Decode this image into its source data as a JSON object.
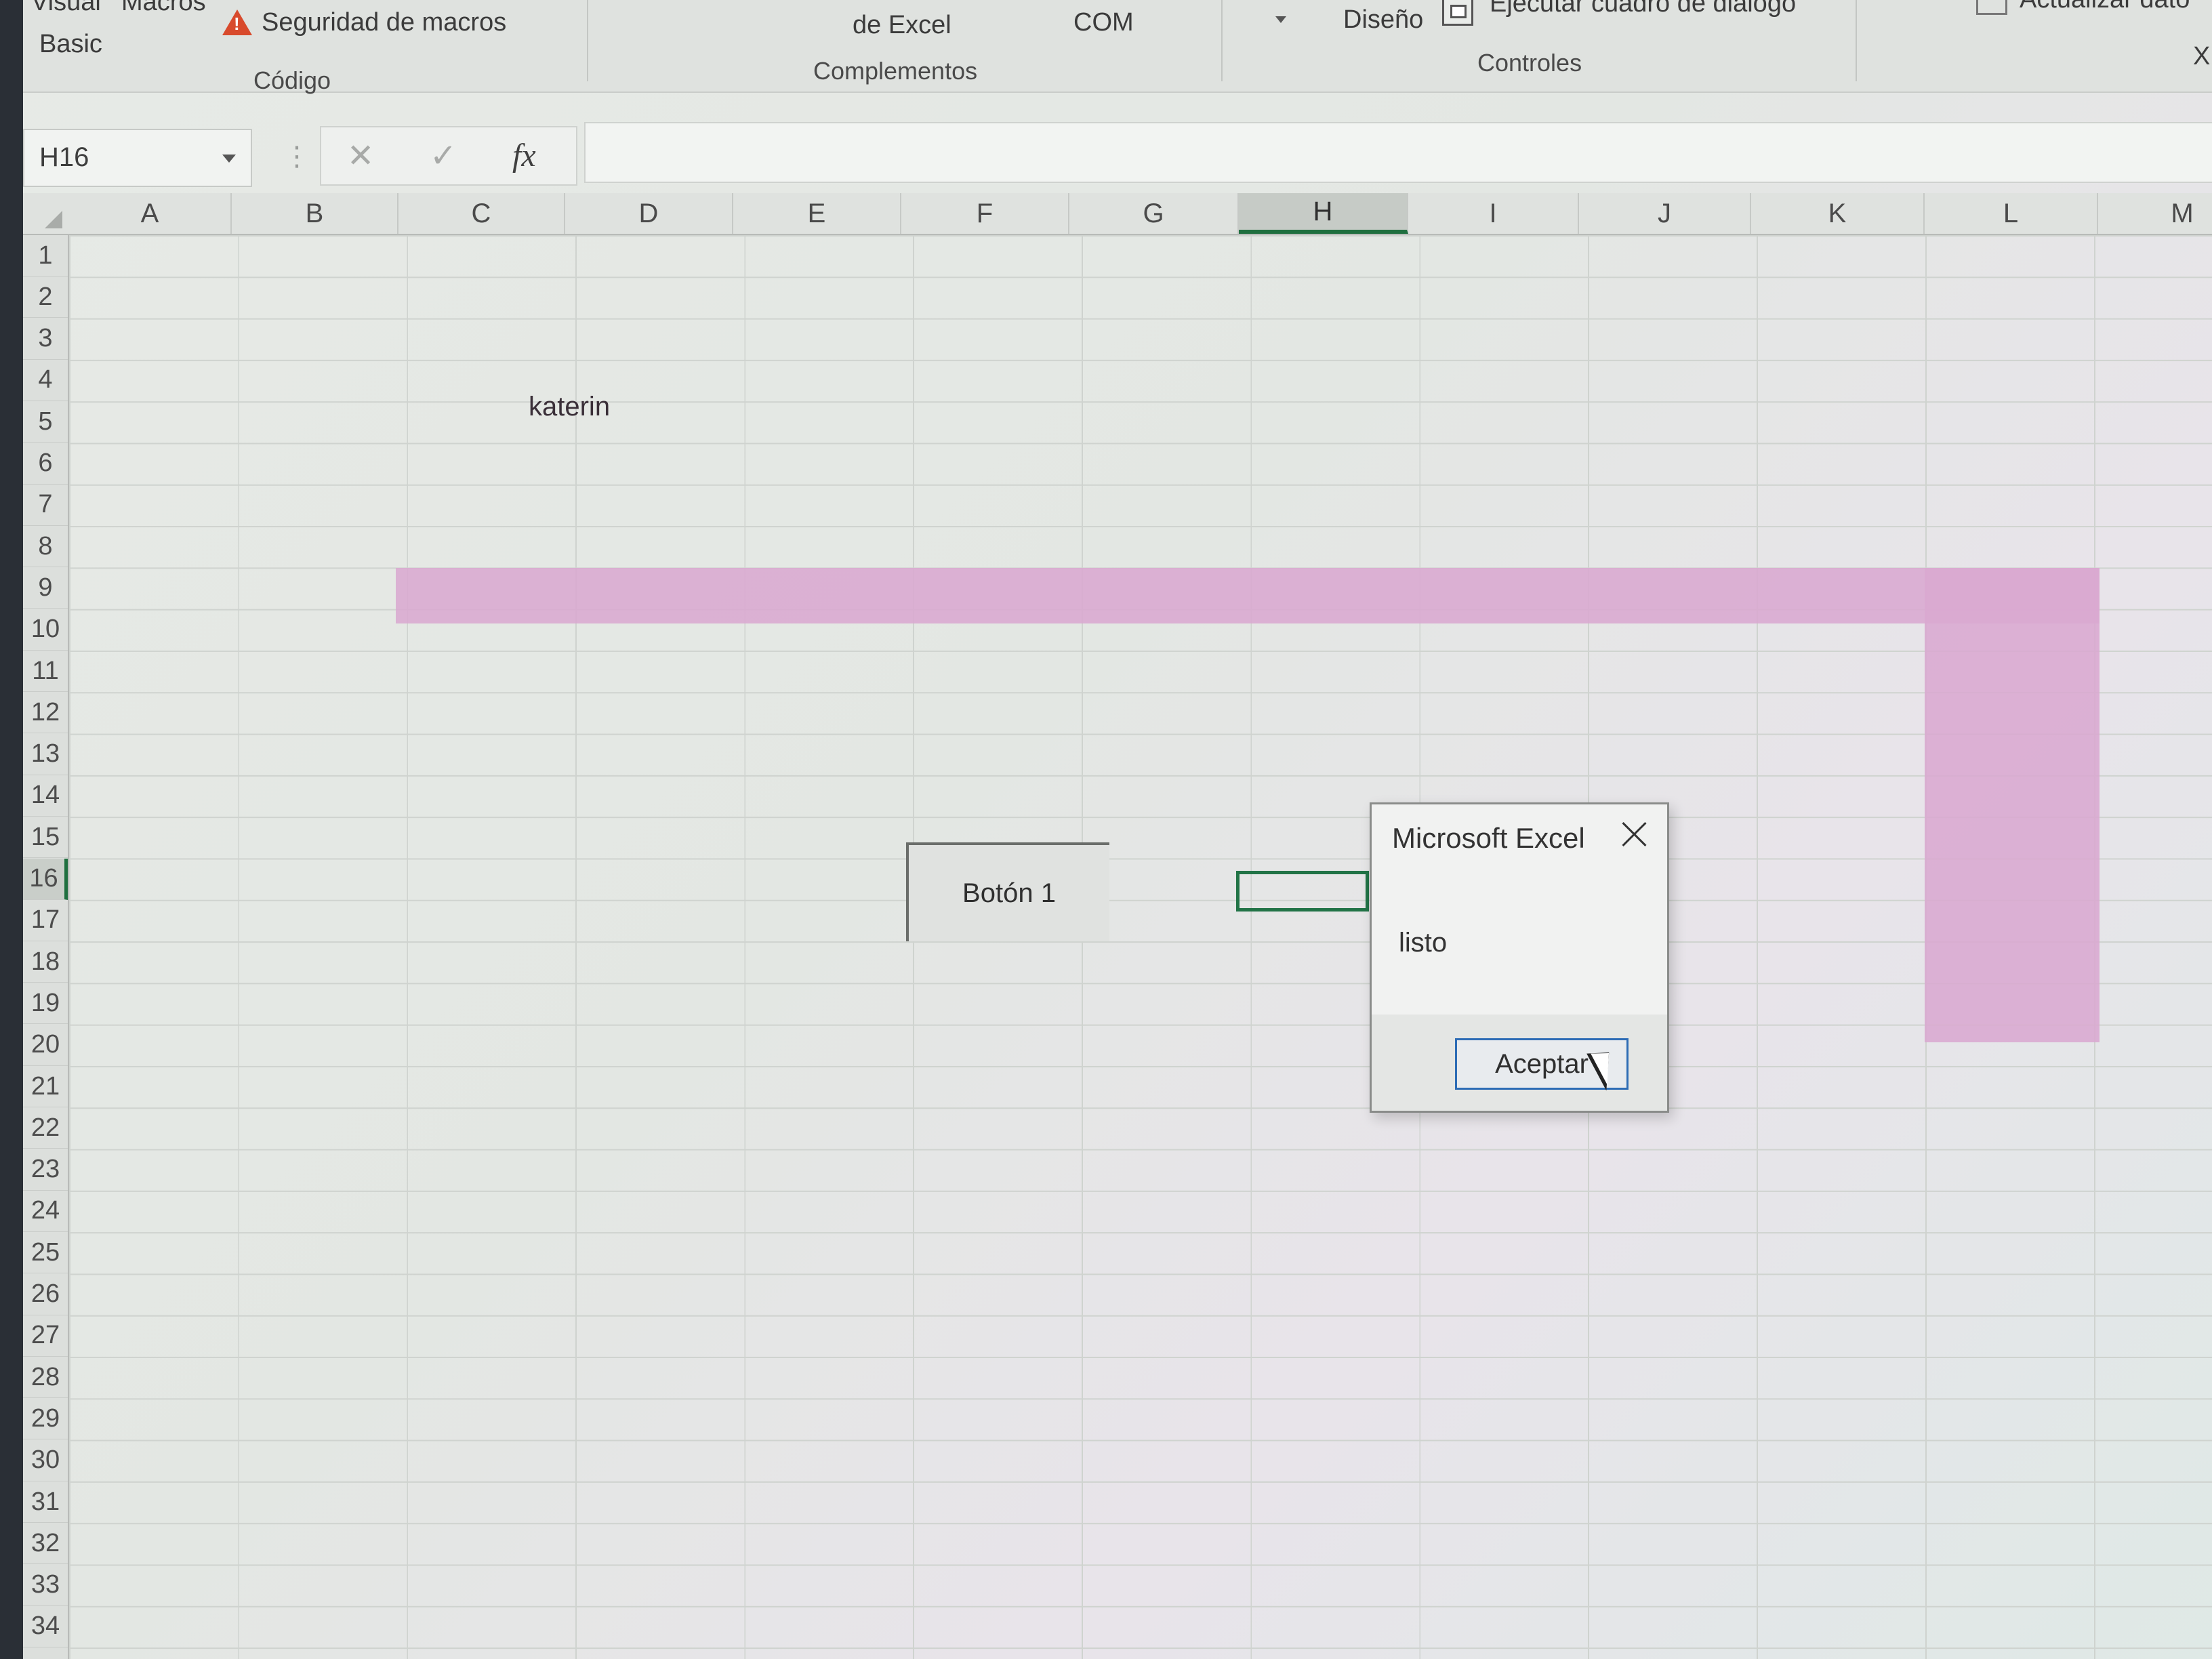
{
  "ribbon": {
    "visual_basic_line1": "Visual",
    "macros_label": "Macros",
    "visual_basic_line2": "Basic",
    "macro_security_label": "Seguridad de macros",
    "group_codigo": "Código",
    "excel_addins_label": "de Excel",
    "com_addins_label": "COM",
    "group_complementos": "Complementos",
    "design_label": "Diseño",
    "run_dialog_label": "Ejecutar cuadro de diálogo",
    "group_controles": "Controles",
    "refresh_data_label": "Actualizar dato",
    "xml_label": "X"
  },
  "formula_bar": {
    "name_box": "H16",
    "cancel_glyph": "✕",
    "enter_glyph": "✓",
    "fx_glyph": "fx",
    "dots": "⋮",
    "formula": ""
  },
  "columns": [
    "A",
    "B",
    "C",
    "D",
    "E",
    "F",
    "G",
    "H",
    "I",
    "J",
    "K",
    "L",
    "M"
  ],
  "active_column": "H",
  "rows": [
    "1",
    "2",
    "3",
    "4",
    "5",
    "6",
    "7",
    "8",
    "9",
    "10",
    "11",
    "12",
    "13",
    "14",
    "15",
    "16",
    "17",
    "18",
    "19",
    "20",
    "21",
    "22",
    "23",
    "24",
    "25",
    "26",
    "27",
    "28",
    "29",
    "30",
    "31",
    "32",
    "33",
    "34"
  ],
  "active_row": "16",
  "cells": {
    "D9": "katerin"
  },
  "fill_color": "#d9a9d0",
  "form_button_label": "Botón 1",
  "msgbox": {
    "title": "Microsoft Excel",
    "message": "listo",
    "ok_label": "Aceptar"
  },
  "accent": "#217346"
}
